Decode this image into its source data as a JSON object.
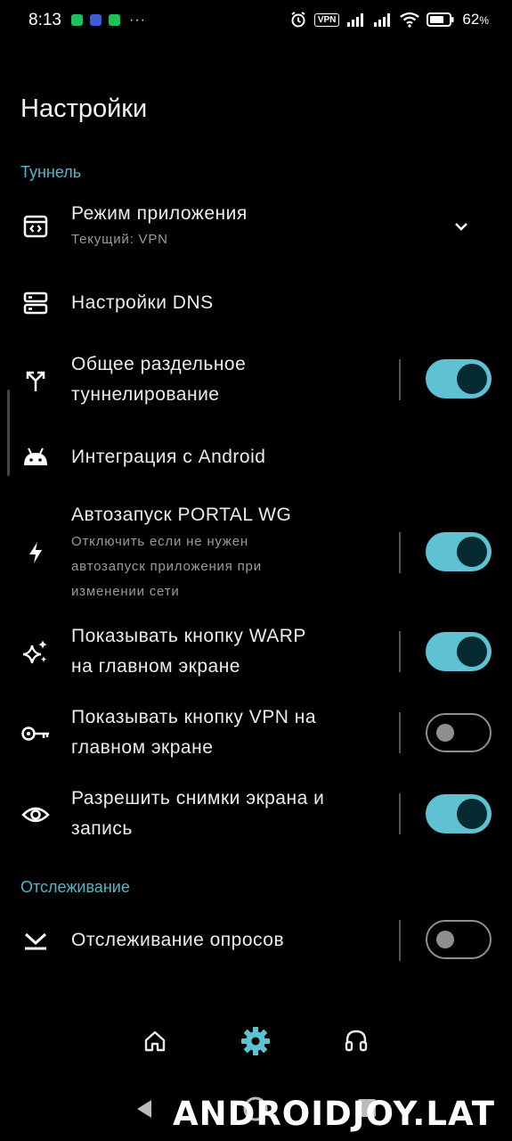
{
  "status_bar": {
    "time": "8:13",
    "vpn_label": "VPN",
    "battery_percent": "62",
    "battery_unit": "%"
  },
  "page": {
    "title": "Настройки"
  },
  "sections": [
    {
      "header": "Туннель"
    },
    {
      "header": "Отслеживание"
    }
  ],
  "settings": {
    "app_mode": {
      "title": "Режим приложения",
      "subtitle": "Текущий: VPN",
      "icon": "app-window-code-icon"
    },
    "dns": {
      "title": "Настройки DNS",
      "icon": "dns-server-icon"
    },
    "split_tunnel": {
      "title_line1": "Общее раздельное",
      "title_line2": "туннелирование",
      "icon": "split-arrow-icon",
      "enabled": true
    },
    "android_integration": {
      "title": "Интеграция с Android",
      "icon": "android-icon"
    },
    "autostart": {
      "title": "Автозапуск PORTAL WG",
      "subtitle_line1": "Отключить если не нужен",
      "subtitle_line2": "автозапуск приложения при",
      "subtitle_line3": "изменении сети",
      "icon": "bolt-icon",
      "enabled": true
    },
    "show_warp": {
      "title_line1": "Показывать кнопку WARP",
      "title_line2": "на главном экране",
      "icon": "sparkle-icon",
      "enabled": true
    },
    "show_vpn": {
      "title_line1": "Показывать кнопку VPN на",
      "title_line2": "главном экране",
      "icon": "key-icon",
      "enabled": false
    },
    "screenshots": {
      "title_line1": "Разрешить снимки экрана и",
      "title_line2": "запись",
      "icon": "eye-icon",
      "enabled": true
    },
    "poll_tracking": {
      "title": "Отслеживание опросов",
      "icon": "poll-check-icon",
      "enabled": false
    }
  },
  "bottom_nav": {
    "items": [
      {
        "name": "home",
        "icon": "home-icon",
        "active": false
      },
      {
        "name": "settings",
        "icon": "gear-icon",
        "active": true
      },
      {
        "name": "support",
        "icon": "headset-icon",
        "active": false
      }
    ]
  },
  "watermark": {
    "text": "ANDROIDJOY.LAT"
  },
  "colors": {
    "accent": "#5fc2d2",
    "section_header": "#4fb8c9",
    "background": "#000000"
  }
}
